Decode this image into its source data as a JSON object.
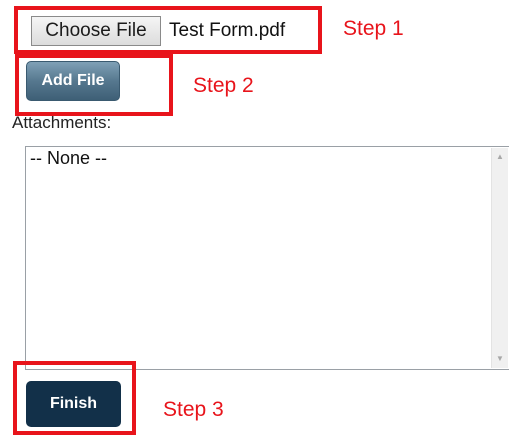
{
  "form": {
    "choose_file_label": "Choose File",
    "selected_file": "Test Form.pdf",
    "add_file_label": "Add File",
    "attachments_label": "Attachments:",
    "attachments_items": [
      "-- None --"
    ],
    "finish_label": "Finish"
  },
  "annotations": {
    "step1": "Step 1",
    "step2": "Step 2",
    "step3": "Step 3"
  },
  "colors": {
    "annotation_red": "#e8141b",
    "add_button_blue": "#56788f",
    "finish_button_navy": "#123049"
  },
  "icons": {
    "scroll_up": "scroll-up-arrow-icon",
    "scroll_down": "scroll-down-arrow-icon"
  }
}
